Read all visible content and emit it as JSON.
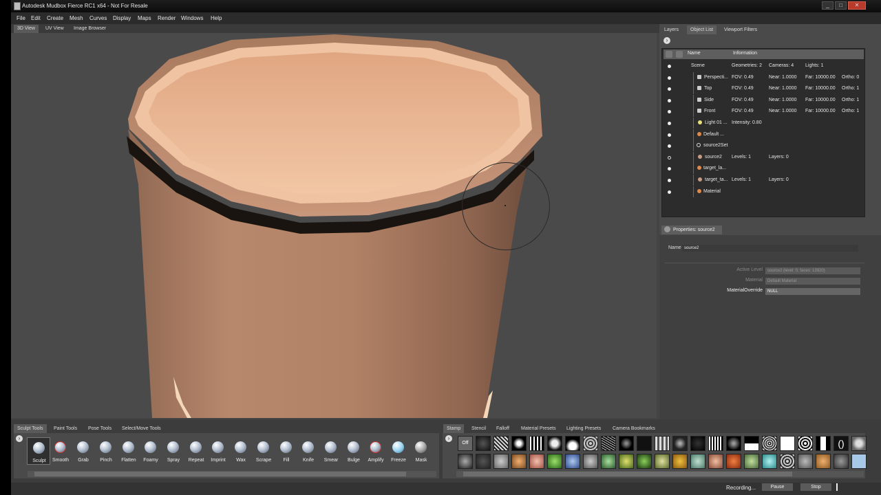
{
  "window": {
    "title": "Autodesk Mudbox Fierce RC1 x64 - Not For Resale",
    "min": "_",
    "max": "□",
    "close": "✕"
  },
  "menu": [
    "File",
    "Edit",
    "Create",
    "Mesh",
    "Curves",
    "Display",
    "Maps",
    "Render",
    "Windows",
    "Help"
  ],
  "view_tabs": [
    "3D View",
    "UV View",
    "Image Browser"
  ],
  "right_tabs": [
    "Layers",
    "Object List",
    "Viewport Filters"
  ],
  "object_list": {
    "headers": {
      "name": "Name",
      "info": "Information"
    },
    "rows": [
      {
        "name": "Scene",
        "c1": "Geometries: 2",
        "c2": "Cameras: 4",
        "c3": "Lights: 1",
        "c4": ""
      },
      {
        "name": "Perspecti...",
        "c1": "FOV: 0.49",
        "c2": "Near: 1.0000",
        "c3": "Far: 10000.00",
        "c4": "Ortho: 0"
      },
      {
        "name": "Top",
        "c1": "FOV: 0.49",
        "c2": "Near: 1.0000",
        "c3": "Far: 10000.00",
        "c4": "Ortho: 1"
      },
      {
        "name": "Side",
        "c1": "FOV: 0.49",
        "c2": "Near: 1.0000",
        "c3": "Far: 10000.00",
        "c4": "Ortho: 1"
      },
      {
        "name": "Front",
        "c1": "FOV: 0.49",
        "c2": "Near: 1.0000",
        "c3": "Far: 10000.00",
        "c4": "Ortho: 1"
      },
      {
        "name": "Light 01 ...",
        "c1": "Intensity: 0.80",
        "c2": "",
        "c3": "",
        "c4": ""
      },
      {
        "name": "Default ...",
        "c1": "",
        "c2": "",
        "c3": "",
        "c4": ""
      },
      {
        "name": "source2Set",
        "c1": "",
        "c2": "",
        "c3": "",
        "c4": ""
      },
      {
        "name": "source2",
        "c1": "Levels: 1",
        "c2": "Layers: 0",
        "c3": "",
        "c4": ""
      },
      {
        "name": "target_la...",
        "c1": "",
        "c2": "",
        "c3": "",
        "c4": ""
      },
      {
        "name": "target_ta...",
        "c1": "Levels: 1",
        "c2": "Layers: 0",
        "c3": "",
        "c4": ""
      },
      {
        "name": "Material",
        "c1": "",
        "c2": "",
        "c3": "",
        "c4": ""
      }
    ]
  },
  "properties": {
    "header": "Properties: source2",
    "name_label": "Name",
    "name_value": "source2",
    "active_level_label": "Active Level",
    "active_level_value": "source2 (level: 0, faces: 13920)",
    "material_label": "Material",
    "material_value": "Default Material",
    "override_label": "MaterialOverride",
    "override_value": "NULL"
  },
  "shelf_tabs_left": [
    "Sculpt Tools",
    "Paint Tools",
    "Pose Tools",
    "Select/Move Tools"
  ],
  "shelf_tabs_right": [
    "Stamp",
    "Stencil",
    "Falloff",
    "Material Presets",
    "Lighting Presets",
    "Camera Bookmarks"
  ],
  "sculpt_tools": [
    "Sculpt",
    "Smooth",
    "Grab",
    "Pinch",
    "Flatten",
    "Foamy",
    "Spray",
    "Repeat",
    "Imprint",
    "Wax",
    "Scrape",
    "Fill",
    "Knife",
    "Smear",
    "Bulge",
    "Amplify",
    "Freeze",
    "Mask"
  ],
  "stamp_off_label": "Off",
  "status": {
    "recording": "Recording...",
    "pause": "Pause",
    "stop": "Stop"
  },
  "colors": {
    "clay": "#d9a27e",
    "clay_dark": "#8a6048",
    "ui_bg": "#444444",
    "close_red": "#b83a2a"
  }
}
